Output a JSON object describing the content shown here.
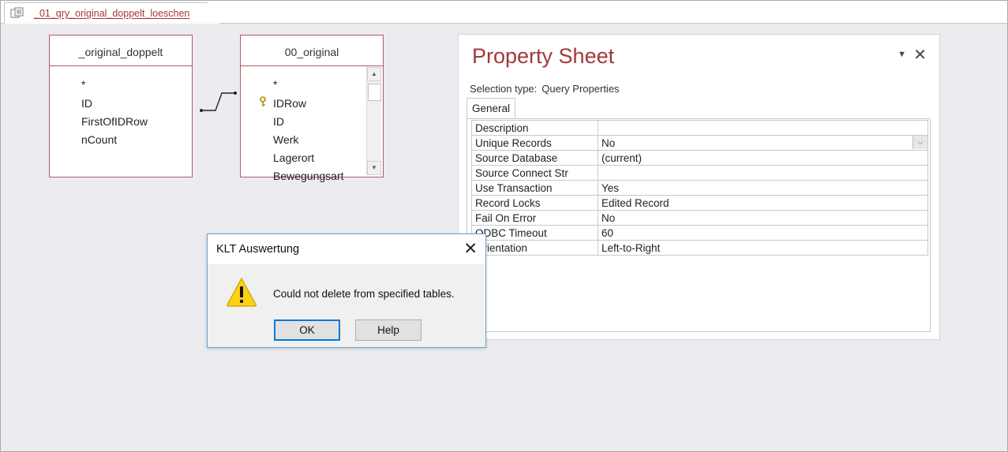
{
  "document_tab": {
    "label": "_01_qry_original_doppelt_loeschen",
    "icon": "query-icon"
  },
  "design": {
    "tables": [
      {
        "name": "_original_doppelt",
        "fields": [
          "*",
          "ID",
          "FirstOfIDRow",
          "nCount"
        ]
      },
      {
        "name": "00_original",
        "fields": [
          "*",
          "IDRow",
          "ID",
          "Werk",
          "Lagerort",
          "Bewegungsart"
        ],
        "key_field": "IDRow"
      }
    ]
  },
  "property_sheet": {
    "title": "Property Sheet",
    "selection_label": "Selection type:",
    "selection_value": "Query Properties",
    "tab": "General",
    "rows": [
      {
        "k": "Description",
        "v": ""
      },
      {
        "k": "Unique Records",
        "v": "No"
      },
      {
        "k": "Source Database",
        "v": "(current)"
      },
      {
        "k": "Source Connect Str",
        "v": ""
      },
      {
        "k": "Use Transaction",
        "v": "Yes"
      },
      {
        "k": "Record Locks",
        "v": "Edited Record"
      },
      {
        "k": "Fail On Error",
        "v": "No"
      },
      {
        "k": "ODBC Timeout",
        "v": "60"
      },
      {
        "k": "Orientation",
        "v": "Left-to-Right"
      }
    ]
  },
  "dialog": {
    "title": "KLT Auswertung",
    "message": "Could not delete from specified tables.",
    "ok_label": "OK",
    "help_label": "Help",
    "icon": "warning-icon"
  },
  "colors": {
    "accent": "#a4373a",
    "table_border": "#b05a60",
    "canvas": "#ececf0",
    "focus": "#0078d7"
  }
}
